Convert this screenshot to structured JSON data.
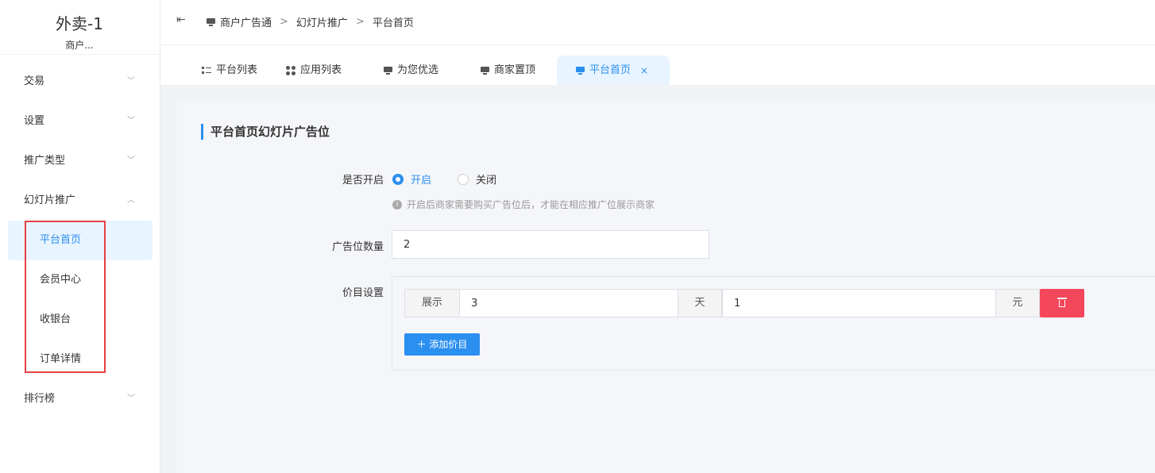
{
  "brand": {
    "title": "外卖-1",
    "subtitle": "商户..."
  },
  "sidebar": {
    "groups": [
      {
        "label": "交易",
        "chevron": "chevron-down-icon"
      },
      {
        "label": "设置",
        "chevron": "chevron-down-icon"
      },
      {
        "label": "推广类型",
        "chevron": "chevron-down-icon"
      },
      {
        "label": "幻灯片推广",
        "chevron": "chevron-up-icon"
      },
      {
        "label": "排行榜",
        "chevron": "chevron-down-icon"
      }
    ],
    "sub_items": [
      {
        "label": "平台首页",
        "active": true
      },
      {
        "label": "会员中心"
      },
      {
        "label": "收银台"
      },
      {
        "label": "订单详情"
      }
    ]
  },
  "breadcrumb": [
    "商户广告通",
    "幻灯片推广",
    "平台首页"
  ],
  "tabs": [
    {
      "label": "平台列表",
      "icon": "list-icon"
    },
    {
      "label": "应用列表",
      "icon": "grid-icon"
    },
    {
      "label": "为您优选",
      "icon": "monitor-icon"
    },
    {
      "label": "商家置顶",
      "icon": "monitor-icon"
    },
    {
      "label": "平台首页",
      "icon": "monitor-icon",
      "active": true,
      "close": "×"
    }
  ],
  "panel": {
    "title": "平台首页幻灯片广告位",
    "enable": {
      "label": "是否开启",
      "option_on": "开启",
      "option_off": "关闭",
      "selected": "开启",
      "hint": "开启后商家需要购买广告位后，才能在相应推广位展示商家"
    },
    "count": {
      "label": "广告位数量",
      "value": "2"
    },
    "price": {
      "label": "价目设置",
      "prefix": "展示",
      "days_value": "3",
      "days_unit": "天",
      "amount_value": "1",
      "amount_unit": "元",
      "add_button": "＋ 添加价目"
    }
  },
  "colors": {
    "accent": "#2b8ff0",
    "danger": "#f5475b",
    "highlight": "#e84040"
  }
}
